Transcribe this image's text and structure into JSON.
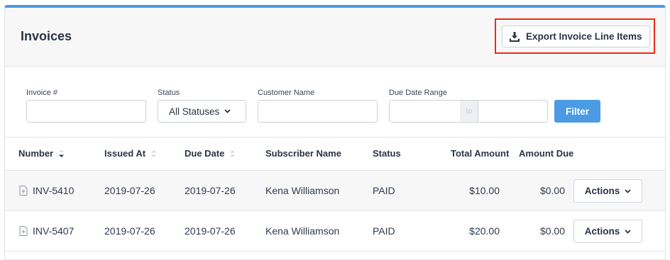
{
  "header": {
    "title": "Invoices",
    "export_label": "Export Invoice Line Items"
  },
  "filters": {
    "invoice_label": "Invoice #",
    "invoice_value": "",
    "status_label": "Status",
    "status_value": "All Statuses",
    "customer_label": "Customer Name",
    "customer_value": "",
    "date_label": "Due Date Range",
    "date_separator": "to",
    "filter_button": "Filter"
  },
  "table": {
    "columns": [
      "Number",
      "Issued At",
      "Due Date",
      "Subscriber Name",
      "Status",
      "Total Amount",
      "Amount Due"
    ],
    "rows": [
      {
        "number": "INV-5410",
        "issued": "2019-07-26",
        "due": "2019-07-26",
        "subscriber": "Kena Williamson",
        "status": "PAID",
        "total": "$10.00",
        "amount_due": "$0.00",
        "actions": "Actions"
      },
      {
        "number": "INV-5407",
        "issued": "2019-07-26",
        "due": "2019-07-26",
        "subscriber": "Kena Williamson",
        "status": "PAID",
        "total": "$20.00",
        "amount_due": "$0.00",
        "actions": "Actions"
      }
    ]
  },
  "colors": {
    "accent": "#4a9be3",
    "highlight_border": "#ee2a1b"
  }
}
